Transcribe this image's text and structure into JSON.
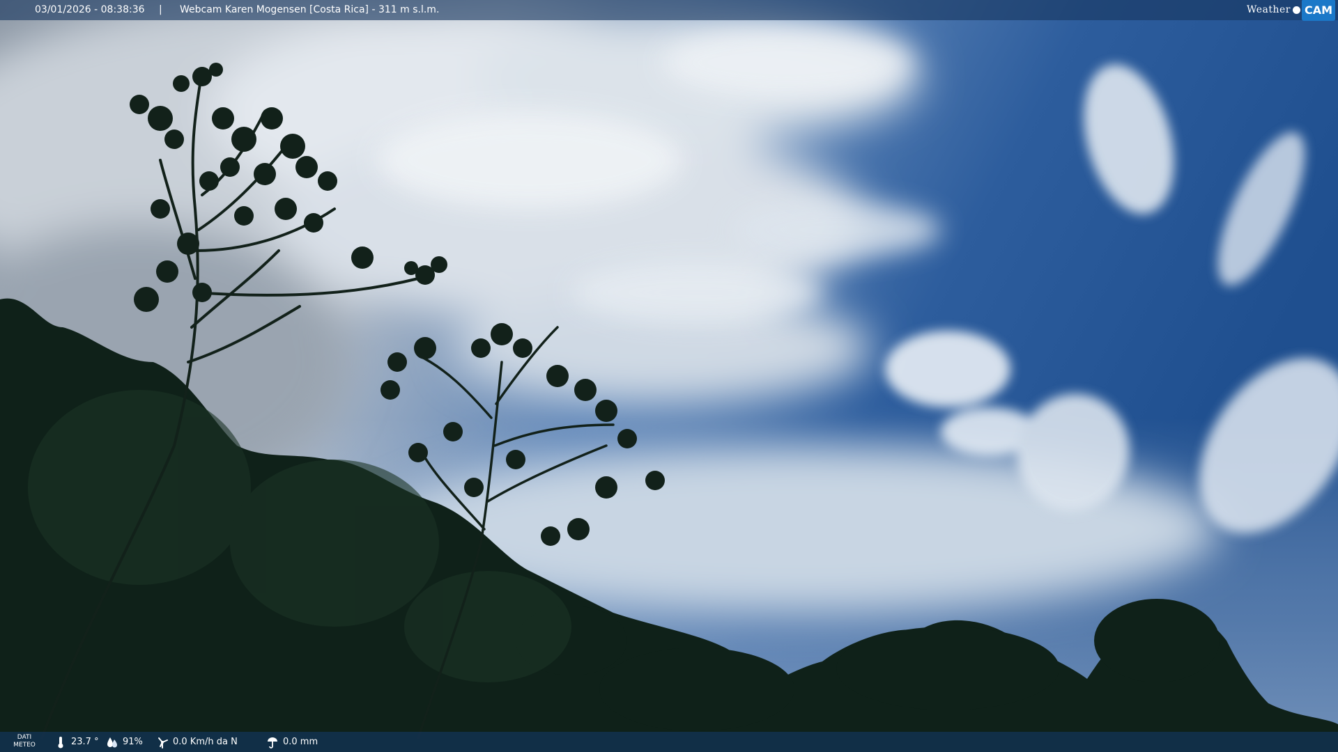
{
  "header": {
    "timestamp": "03/01/2026 - 08:38:36",
    "separator": "|",
    "title": "Webcam Karen Mogensen [Costa Rica]  -  311 m s.l.m."
  },
  "logo": {
    "word": "Weather",
    "badge": "CAM"
  },
  "weather": {
    "section_label_line1": "DATI",
    "section_label_line2": "METEO",
    "temperature": "23.7 °",
    "humidity": "91%",
    "wind": "0.0 Km/h da N",
    "rain": "0.0 mm"
  },
  "icons": {
    "temperature": "thermometer-icon",
    "humidity": "humidity-drop-icon",
    "wind": "wind-icon",
    "rain": "rain-icon"
  },
  "colors": {
    "sky_deep": "#1f4f8f",
    "cloud": "#dfe6ee",
    "foliage": "#0d1c16"
  }
}
